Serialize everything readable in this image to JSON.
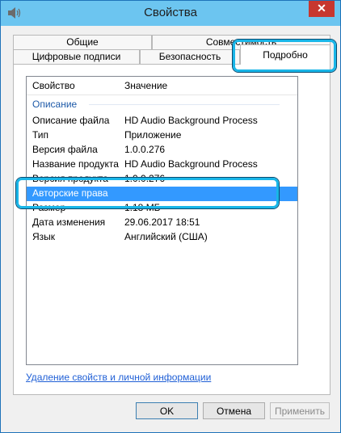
{
  "window": {
    "title": "Свойства",
    "close_label": "✕",
    "icon": "speaker-icon"
  },
  "tabs": {
    "row1": [
      "Общие",
      "Совместимость"
    ],
    "row2": [
      "Цифровые подписи",
      "Безопасность",
      "Подробно"
    ],
    "active": "Подробно"
  },
  "details": {
    "col_property": "Свойство",
    "col_value": "Значение",
    "group": "Описание",
    "rows": [
      {
        "p": "Описание файла",
        "v": "HD Audio Background Process"
      },
      {
        "p": "Тип",
        "v": "Приложение"
      },
      {
        "p": "Версия файла",
        "v": "1.0.0.276"
      },
      {
        "p": "Название продукта",
        "v": "HD Audio Background Process"
      },
      {
        "p": "Версия продукта",
        "v": "1.0.0.276"
      },
      {
        "p": "Авторские права",
        "v": ""
      },
      {
        "p": "Размер",
        "v": "1.18 МБ"
      },
      {
        "p": "Дата изменения",
        "v": "29.06.2017 18:51"
      },
      {
        "p": "Язык",
        "v": "Английский (США)"
      }
    ],
    "selected_row": "Авторские права"
  },
  "link": "Удаление свойств и личной информации",
  "buttons": {
    "ok": "OK",
    "cancel": "Отмена",
    "apply": "Применить"
  },
  "colors": {
    "highlight": "#19b6e8",
    "selection": "#3399ff",
    "titlebar": "#6cc5f0"
  }
}
